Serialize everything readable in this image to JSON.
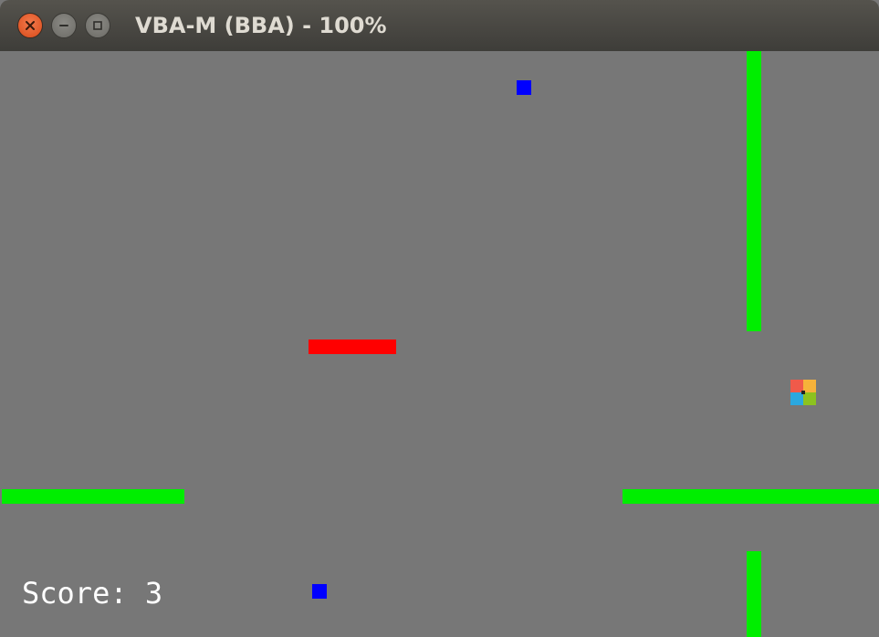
{
  "window": {
    "title": "VBA-M (BBA) - 100%",
    "close_icon": "close-icon",
    "minimize_icon": "minimize-icon",
    "maximize_icon": "maximize-icon"
  },
  "game": {
    "score_label": "Score:",
    "score_value": "3",
    "colors": {
      "background": "#777777",
      "walls": "#00ee00",
      "paddle": "#ff0000",
      "collectibles": "#0000ff"
    }
  }
}
